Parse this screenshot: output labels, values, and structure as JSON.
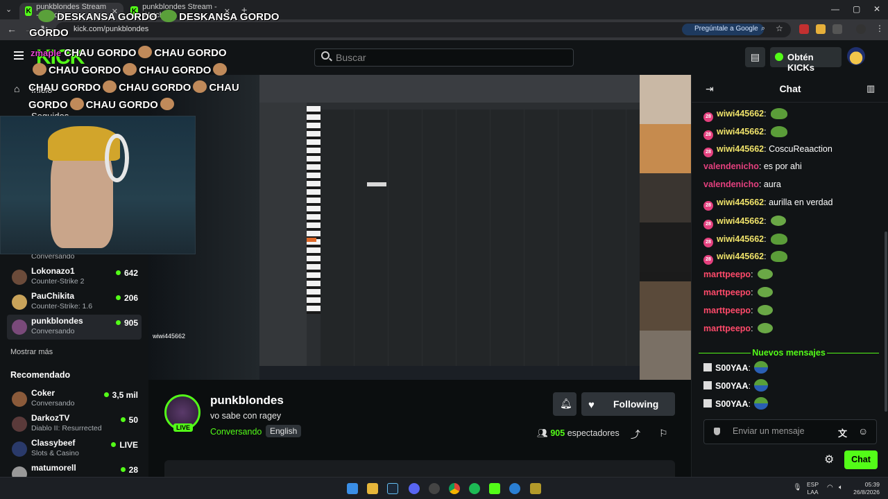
{
  "browser": {
    "tabs": [
      {
        "title": "punkblondes Stream - Watch",
        "active": true
      },
      {
        "title": "punkblondes Stream - Watch",
        "active": false
      }
    ],
    "new_tab": "+",
    "url": "kick.com/punkblondes",
    "ask_google": "Pregúntale a Google",
    "window_controls": [
      "—",
      "▢",
      "✕"
    ]
  },
  "header": {
    "search_placeholder": "Buscar",
    "kicks_button": "Obtén KICKs",
    "logo": "KICK"
  },
  "overlay": {
    "line1": "DESKANSA GORDO",
    "line2": "DESKANSA GORDO",
    "line3": "GORDO",
    "chau": [
      "CHAU GORDO",
      "CHAU GORDO",
      "CHAU GORDO",
      "CHAU GORDO",
      "CHAU GORDO",
      "CHAU GORDO",
      "CHAU",
      "GORDO",
      "CHAU GORDO"
    ],
    "zmaple": "zmaple"
  },
  "sidebar": {
    "home": "Inicio",
    "following_partial": "Seguidos",
    "channels": [
      {
        "name": "",
        "game": "Conversando",
        "count": ""
      },
      {
        "name": "Lokonazo1",
        "game": "Counter-Strike 2",
        "count": "642"
      },
      {
        "name": "PauChikita",
        "game": "Counter-Strike: 1.6",
        "count": "206"
      },
      {
        "name": "punkblondes",
        "game": "Conversando",
        "count": "905"
      }
    ],
    "show_more": "Mostrar más",
    "recommended_title": "Recomendado",
    "recommended": [
      {
        "name": "Coker",
        "game": "Conversando",
        "count": "3,5 mil"
      },
      {
        "name": "DarkozTV",
        "game": "Diablo II: Resurrected",
        "count": "50"
      },
      {
        "name": "Classybeef",
        "game": "Slots & Casino",
        "count": "LIVE"
      },
      {
        "name": "matumorell",
        "game": "",
        "count": "28"
      }
    ]
  },
  "video_chat_overlay": [
    "wiwi445662"
  ],
  "stream": {
    "streamer": "punkblondes",
    "title": "vo sabe con ragey",
    "category": "Conversando",
    "language": "English",
    "live": "LIVE",
    "follow": "Following",
    "viewers": "905",
    "viewers_label": "espectadores"
  },
  "chat": {
    "title": "Chat",
    "messages": [
      {
        "user": "wiwi445662",
        "text": "",
        "emote": "frog",
        "badge": true,
        "color": "#f0e36a"
      },
      {
        "user": "wiwi445662",
        "text": "",
        "emote": "frog",
        "badge": true,
        "color": "#f0e36a"
      },
      {
        "user": "wiwi445662",
        "text": "CoscuReaaction",
        "emote": "",
        "badge": true,
        "color": "#f0e36a"
      },
      {
        "user": "valendenicho",
        "text": "es por ahi",
        "emote": "",
        "badge": false,
        "color": "#e4407e"
      },
      {
        "user": "valendenicho",
        "text": "aura",
        "emote": "",
        "badge": false,
        "color": "#e4407e"
      },
      {
        "user": "wiwi445662",
        "text": "aurilla en verdad",
        "emote": "",
        "badge": true,
        "color": "#f0e36a"
      },
      {
        "user": "wiwi445662",
        "text": "",
        "emote": "pepe",
        "badge": true,
        "color": "#f0e36a"
      },
      {
        "user": "wiwi445662",
        "text": "",
        "emote": "frog",
        "badge": true,
        "color": "#f0e36a"
      },
      {
        "user": "wiwi445662",
        "text": "",
        "emote": "frog",
        "badge": true,
        "color": "#f0e36a"
      },
      {
        "user": "marttpeepo",
        "text": "",
        "emote": "pepe",
        "badge": false,
        "color": "#ff4a6a"
      },
      {
        "user": "marttpeepo",
        "text": "",
        "emote": "pepe",
        "badge": false,
        "color": "#ff4a6a"
      },
      {
        "user": "marttpeepo",
        "text": "",
        "emote": "pepe",
        "badge": false,
        "color": "#ff4a6a"
      },
      {
        "user": "marttpeepo",
        "text": "",
        "emote": "pepe",
        "badge": false,
        "color": "#ff4a6a"
      }
    ],
    "new_messages": "Nuevos mensajes",
    "new": [
      {
        "user": "S00YAA",
        "emote": "bluefrog"
      },
      {
        "user": "S00YAA",
        "emote": "bluefrog"
      },
      {
        "user": "S00YAA",
        "emote": "bluefrog"
      }
    ],
    "input_placeholder": "Enviar un mensaje",
    "send": "Chat"
  },
  "taskbar": {
    "lang": "ESP",
    "lang2": "LAA",
    "time": "05:39",
    "date": "26/8/2026"
  },
  "colors": {
    "accent": "#53fc18",
    "bg": "#0b0e0f"
  }
}
